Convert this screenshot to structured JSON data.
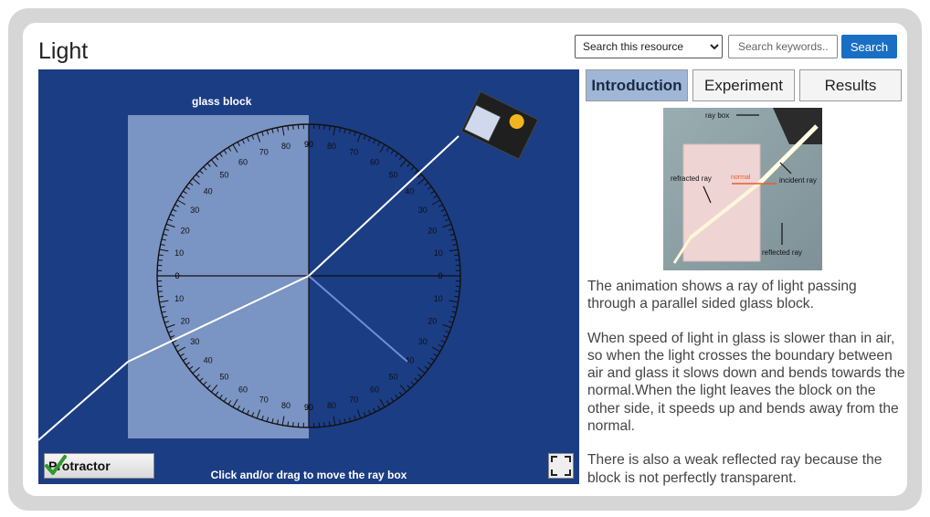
{
  "page": {
    "title": "Light"
  },
  "search": {
    "scope_selected": "Search this resource",
    "placeholder": "Search keywords..",
    "button_label": "Search"
  },
  "sim": {
    "block_label": "glass block",
    "hint": "Click and/or drag to move the ray box",
    "protractor_label": "Protractor",
    "protractor_ticks": [
      "90",
      "80",
      "70",
      "60",
      "50",
      "40",
      "30",
      "20",
      "10",
      "0"
    ]
  },
  "tabs": [
    {
      "label": "Introduction",
      "active": true
    },
    {
      "label": "Experiment",
      "active": false
    },
    {
      "label": "Results",
      "active": false
    }
  ],
  "photo": {
    "labels": {
      "ray_box": "ray box",
      "refracted": "refracted ray",
      "normal": "normal",
      "incident": "incident ray",
      "reflected": "reflected ray"
    }
  },
  "intro": {
    "p1": "The animation shows a ray of light passing through a parallel sided glass block.",
    "p2": "When speed of light in glass is slower than in air, so when the light crosses the boundary between air and glass it slows down and bends towards the normal.When the light leaves the block on the other side, it speeds up and bends away from the normal.",
    "p3": "There is also a weak reflected ray because the block is not perfectly transparent."
  },
  "colors": {
    "sim_bg": "#1b3d84",
    "accent": "#1a6fc4",
    "active_tab": "#9fb6d7"
  }
}
